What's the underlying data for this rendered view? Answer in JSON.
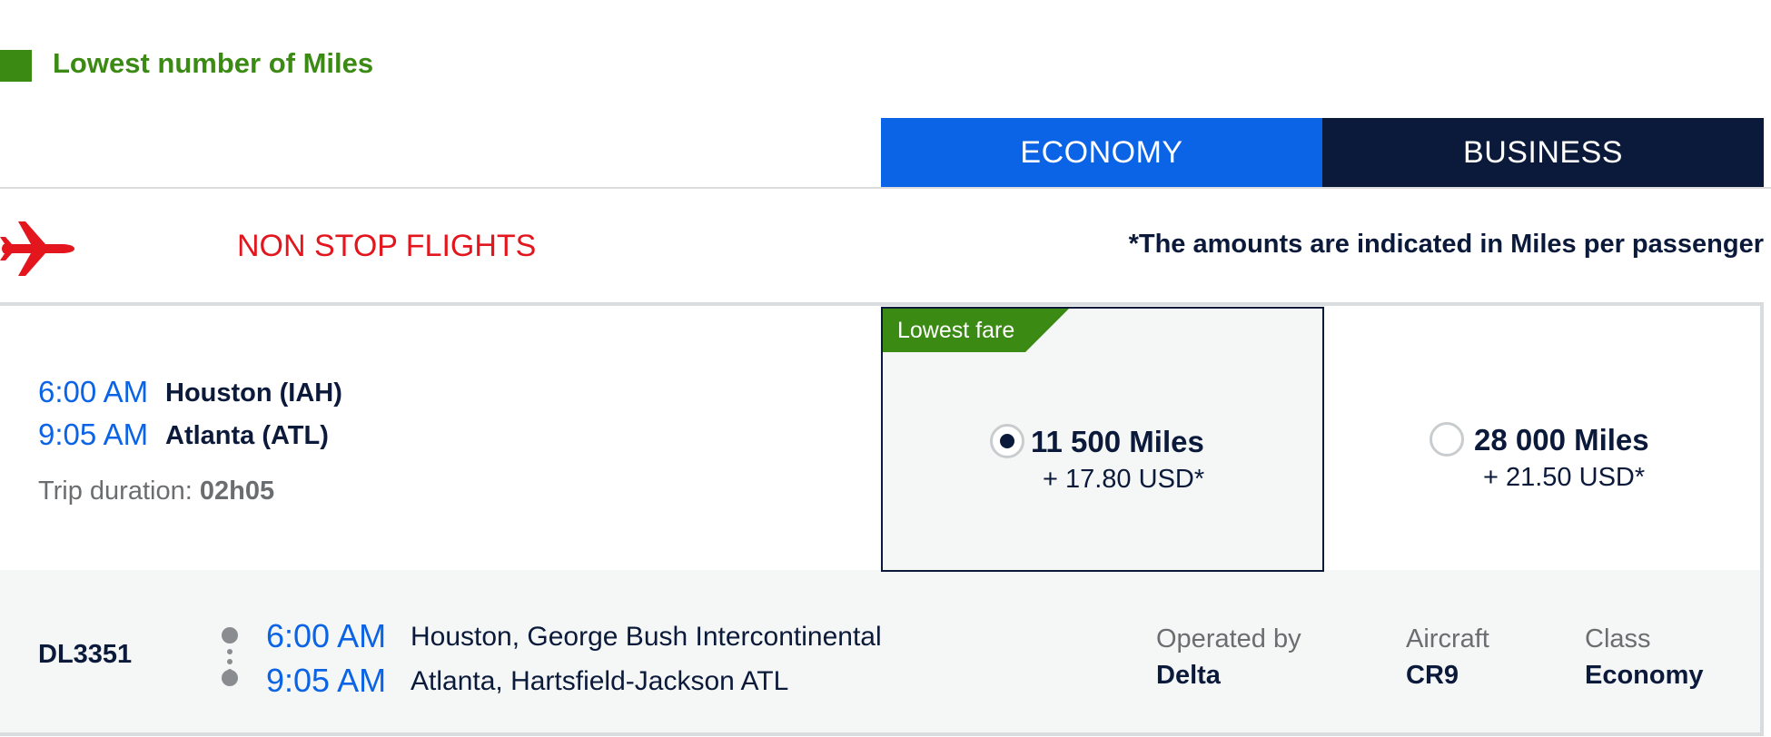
{
  "legend": {
    "label": "Lowest number of Miles",
    "color": "#3a8a13"
  },
  "cabin_tabs": [
    {
      "label": "ECONOMY",
      "selected": true,
      "color": "#0b63e5"
    },
    {
      "label": "BUSINESS",
      "selected": false,
      "color": "#0b1a3a"
    }
  ],
  "section": {
    "icon": "airplane-icon",
    "title": "NON STOP FLIGHTS",
    "note": "*The amounts are indicated in Miles per passenger"
  },
  "flight": {
    "departure_time": "6:00 AM",
    "departure_city": "Houston (IAH)",
    "arrival_time": "9:05 AM",
    "arrival_city": "Atlanta (ATL)",
    "duration_label": "Trip duration:",
    "duration_value": "02h05",
    "fares": [
      {
        "badge": "Lowest fare",
        "miles": "11 500 Miles",
        "tax": "+ 17.80 USD*",
        "selected": true
      },
      {
        "miles": "28 000 Miles",
        "tax": "+ 21.50 USD*",
        "selected": false
      }
    ],
    "segment": {
      "flight_number": "DL3351",
      "departure_time": "6:00 AM",
      "departure_airport": "Houston, George Bush Intercontinental",
      "arrival_time": "9:05 AM",
      "arrival_airport": "Atlanta, Hartsfield-Jackson ATL",
      "operated_by_label": "Operated by",
      "operated_by_value": "Delta",
      "aircraft_label": "Aircraft",
      "aircraft_value": "CR9",
      "class_label": "Class",
      "class_value": "Economy"
    }
  }
}
